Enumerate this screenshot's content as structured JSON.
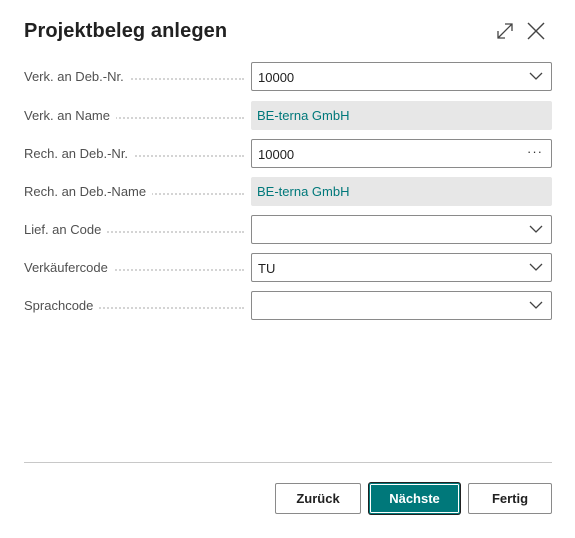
{
  "dialog": {
    "title": "Projektbeleg anlegen",
    "icons": {
      "expand": "expand-icon",
      "close": "close-icon"
    }
  },
  "fields": [
    {
      "label": "Verk. an Deb.-Nr.",
      "value": "10000",
      "control": "dropdown"
    },
    {
      "label": "Verk. an Name",
      "value": "BE-terna GmbH",
      "control": "readonly"
    },
    {
      "label": "Rech. an Deb.-Nr.",
      "value": "10000",
      "control": "lookup",
      "lookup_glyph": "···"
    },
    {
      "label": "Rech. an Deb.-Name",
      "value": "BE-terna GmbH",
      "control": "readonly"
    },
    {
      "label": "Lief. an Code",
      "value": "",
      "control": "dropdown"
    },
    {
      "label": "Verkäufercode",
      "value": "TU",
      "control": "dropdown"
    },
    {
      "label": "Sprachcode",
      "value": "",
      "control": "dropdown"
    }
  ],
  "buttons": {
    "back": "Zurück",
    "next": "Nächste",
    "finish": "Fertig"
  },
  "colors": {
    "accent": "#00787a",
    "readonly_bg": "#e7e7e7",
    "readonly_text": "#00787a"
  }
}
